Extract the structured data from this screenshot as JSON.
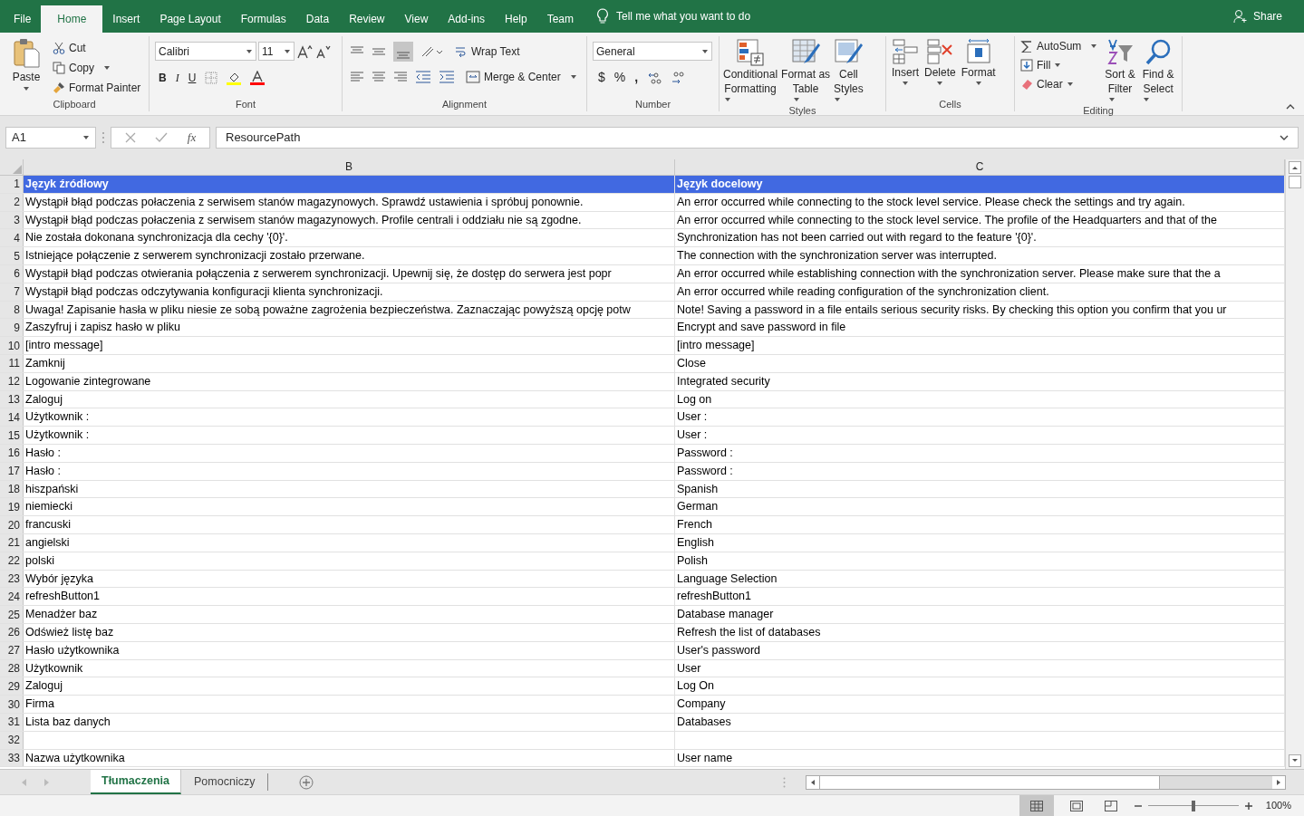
{
  "tabs": [
    {
      "label": "File",
      "selected": false
    },
    {
      "label": "Home",
      "selected": true
    },
    {
      "label": "Insert",
      "selected": false
    },
    {
      "label": "Page Layout",
      "selected": false
    },
    {
      "label": "Formulas",
      "selected": false
    },
    {
      "label": "Data",
      "selected": false
    },
    {
      "label": "Review",
      "selected": false
    },
    {
      "label": "View",
      "selected": false
    },
    {
      "label": "Add-ins",
      "selected": false
    },
    {
      "label": "Help",
      "selected": false
    },
    {
      "label": "Team",
      "selected": false
    }
  ],
  "tell_me": "Tell me what you want to do",
  "share": "Share",
  "clipboard": {
    "paste": "Paste",
    "cut": "Cut",
    "copy": "Copy",
    "format_painter": "Format Painter",
    "group": "Clipboard"
  },
  "font": {
    "name": "Calibri",
    "size": "11",
    "bold": "B",
    "italic": "I",
    "underline": "U",
    "group": "Font"
  },
  "alignment": {
    "wrap": "Wrap Text",
    "merge": "Merge & Center",
    "group": "Alignment"
  },
  "number": {
    "format": "General",
    "currency": "$",
    "percent": "%",
    "comma": ",",
    "group": "Number"
  },
  "styles": {
    "conditional_1": "Conditional",
    "conditional_2": "Formatting",
    "table_1": "Format as",
    "table_2": "Table",
    "cell_1": "Cell",
    "cell_2": "Styles",
    "group": "Styles"
  },
  "cells": {
    "insert": "Insert",
    "delete": "Delete",
    "format": "Format",
    "group": "Cells"
  },
  "editing": {
    "autosum": "AutoSum",
    "fill": "Fill",
    "clear": "Clear",
    "sort_1": "Sort &",
    "sort_2": "Filter",
    "find_1": "Find &",
    "find_2": "Select",
    "group": "Editing"
  },
  "formula_bar": {
    "name_box": "A1",
    "fx": "fx",
    "value": "ResourcePath"
  },
  "columns": [
    "B",
    "C"
  ],
  "rows": [
    {
      "num": "1",
      "kind": "header",
      "b": "Język źródłowy",
      "c": "Język docelowy"
    },
    {
      "num": "2",
      "kind": "data",
      "b": "Wystąpił błąd podczas połaczenia z serwisem stanów magazynowych. Sprawdź ustawienia i spróbuj ponownie.",
      "c": "An error occurred while connecting to the stock level service. Please check the settings and try again."
    },
    {
      "num": "3",
      "kind": "data",
      "b": "Wystąpił błąd podczas połaczenia  z serwisem stanów magazynowych. Profile centrali i oddziału nie są zgodne.",
      "c": "An error occurred while connecting to the stock level service. The profile of the Headquarters and that of the"
    },
    {
      "num": "4",
      "kind": "data",
      "b": "Nie została dokonana synchronizacja dla cechy '{0}'.",
      "c": "Synchronization has not been carried out with regard to the feature '{0}'."
    },
    {
      "num": "5",
      "kind": "data",
      "b": "Istniejące połączenie z serwerem synchronizacji zostało przerwane.",
      "c": "The connection with the synchronization server was interrupted."
    },
    {
      "num": "6",
      "kind": "data",
      "b": "Wystąpił błąd podczas otwierania połączenia z serwerem synchronizacji. Upewnij się, że dostęp do serwera jest popr",
      "c": "An error occurred while establishing connection with the synchronization server. Please make sure that the a"
    },
    {
      "num": "7",
      "kind": "data",
      "b": "Wystąpił błąd podczas odczytywania konfiguracji klienta synchronizacji.",
      "c": "An error occurred while reading configuration of the synchronization client."
    },
    {
      "num": "8",
      "kind": "data",
      "b": "Uwaga! Zapisanie hasła w pliku niesie ze sobą poważne zagrożenia bezpieczeństwa. Zaznaczając powyższą opcję potw",
      "c": "Note! Saving a password in a file entails serious security risks. By checking this option you confirm that you ur"
    },
    {
      "num": "9",
      "kind": "data",
      "b": "Zaszyfruj i zapisz hasło w pliku",
      "c": "Encrypt and save password in file"
    },
    {
      "num": "10",
      "kind": "data",
      "b": "[intro message]",
      "c": "[intro message]"
    },
    {
      "num": "11",
      "kind": "data",
      "b": "Zamknij",
      "c": "Close"
    },
    {
      "num": "12",
      "kind": "data",
      "b": "Logowanie zintegrowane",
      "c": "Integrated security"
    },
    {
      "num": "13",
      "kind": "data",
      "b": "Zaloguj",
      "c": "Log on"
    },
    {
      "num": "14",
      "kind": "data",
      "b": "Użytkownik :",
      "c": "User :"
    },
    {
      "num": "15",
      "kind": "data",
      "b": "Użytkownik :",
      "c": "User :"
    },
    {
      "num": "16",
      "kind": "data",
      "b": "Hasło :",
      "c": "Password :"
    },
    {
      "num": "17",
      "kind": "data",
      "b": "Hasło :",
      "c": "Password :"
    },
    {
      "num": "18",
      "kind": "data",
      "b": "hiszpański",
      "c": "Spanish"
    },
    {
      "num": "19",
      "kind": "data",
      "b": "niemiecki",
      "c": "German"
    },
    {
      "num": "20",
      "kind": "data",
      "b": "francuski",
      "c": "French"
    },
    {
      "num": "21",
      "kind": "data",
      "b": "angielski",
      "c": "English"
    },
    {
      "num": "22",
      "kind": "data",
      "b": "polski",
      "c": "Polish"
    },
    {
      "num": "23",
      "kind": "data",
      "b": "Wybór języka",
      "c": "Language Selection"
    },
    {
      "num": "24",
      "kind": "data",
      "b": "refreshButton1",
      "c": "refreshButton1"
    },
    {
      "num": "25",
      "kind": "data",
      "b": "Menadżer baz",
      "c": "Database manager"
    },
    {
      "num": "26",
      "kind": "data",
      "b": "Odśwież listę baz",
      "c": "Refresh the list of databases"
    },
    {
      "num": "27",
      "kind": "data",
      "b": "Hasło użytkownika",
      "c": "User's password"
    },
    {
      "num": "28",
      "kind": "data",
      "b": "Użytkownik",
      "c": "User"
    },
    {
      "num": "29",
      "kind": "data",
      "b": "Zaloguj",
      "c": "Log On"
    },
    {
      "num": "30",
      "kind": "data",
      "b": "Firma",
      "c": "Company"
    },
    {
      "num": "31",
      "kind": "data",
      "b": "Lista baz danych",
      "c": "Databases"
    },
    {
      "num": "32",
      "kind": "data"
    },
    {
      "num": "33",
      "kind": "data",
      "b": "Nazwa użytkownika",
      "c": "User name"
    }
  ],
  "sheets": [
    {
      "label": "Tłumaczenia",
      "selected": true
    },
    {
      "label": "Pomocniczy",
      "selected": false
    }
  ],
  "zoom_slider": {
    "level": 0.5
  },
  "zoom": "100%"
}
